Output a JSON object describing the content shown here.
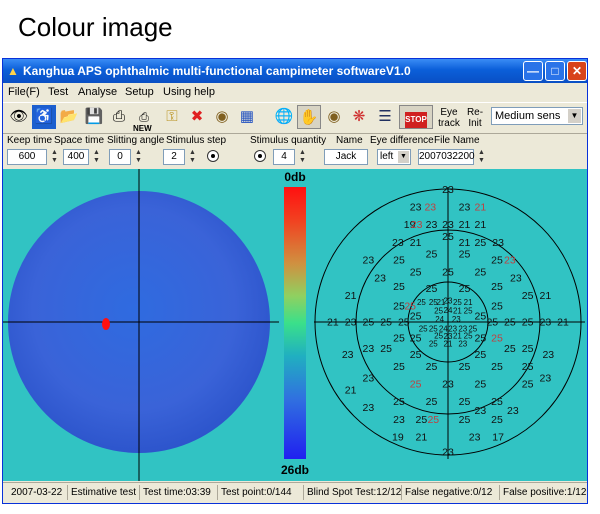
{
  "caption": "Colour image",
  "window": {
    "title": "Kanghua APS ophthalmic multi-functional campimeter softwareV1.0"
  },
  "menu": [
    "File(F)",
    "Test",
    "Analyse",
    "Setup",
    "Using help"
  ],
  "toolbar": {
    "eye_track_label": "Eye track",
    "reinit_label": "Re- Init",
    "new_label": "NEW",
    "stop_label": "STOP",
    "sensitivity_value": "Medium sens"
  },
  "params": {
    "labels": {
      "keep_time": "Keep time",
      "space_time": "Space time",
      "slitting_angle": "Slitting angle",
      "stimulus_step": "Stimulus step",
      "stimulus_quantity": "Stimulus quantity",
      "name": "Name",
      "eye_difference": "Eye difference",
      "file_name": "File Name"
    },
    "keep_time": "600",
    "space_time": "400",
    "slitting_angle": "0",
    "stimulus_step": "2",
    "stimulus_quantity": "4",
    "name": "Jack",
    "eye_difference": "left",
    "file_name": "2007032200"
  },
  "scale": {
    "top_label": "0db",
    "bottom_label": "26db"
  },
  "grid_points": [
    {
      "t": "23",
      "x": 0,
      "y": -22.5
    },
    {
      "t": "23",
      "x": -5.5,
      "y": -19.5
    },
    {
      "t": "23",
      "x": -3,
      "y": -19.5,
      "c": "#c04040"
    },
    {
      "t": "23",
      "x": 2.8,
      "y": -19.5
    },
    {
      "t": "21",
      "x": 5.5,
      "y": -19.5,
      "c": "#c04040"
    },
    {
      "t": "19",
      "x": -6.5,
      "y": -16.5
    },
    {
      "t": "23",
      "x": -5.3,
      "y": -16.5,
      "c": "#c04040"
    },
    {
      "t": "23",
      "x": -2.8,
      "y": -16.5
    },
    {
      "t": "23",
      "x": 0,
      "y": -16.5
    },
    {
      "t": "21",
      "x": 2.8,
      "y": -16.5
    },
    {
      "t": "21",
      "x": 5.5,
      "y": -16.5
    },
    {
      "t": "23",
      "x": -8.5,
      "y": -13.5
    },
    {
      "t": "21",
      "x": -5.5,
      "y": -13.5
    },
    {
      "t": "25",
      "x": 0,
      "y": -14.5
    },
    {
      "t": "21",
      "x": 2.8,
      "y": -13.5
    },
    {
      "t": "25",
      "x": 5.5,
      "y": -13.5
    },
    {
      "t": "23",
      "x": 8.5,
      "y": -13.5
    },
    {
      "t": "23",
      "x": -13.5,
      "y": -10.5
    },
    {
      "t": "25",
      "x": -8.3,
      "y": -10.5
    },
    {
      "t": "25",
      "x": -2.8,
      "y": -11.5
    },
    {
      "t": "25",
      "x": 2.8,
      "y": -11.5
    },
    {
      "t": "25",
      "x": 8.3,
      "y": -10.5
    },
    {
      "t": "23",
      "x": 10.5,
      "y": -10.5,
      "c": "#c04040"
    },
    {
      "t": "25",
      "x": -5.5,
      "y": -8.5
    },
    {
      "t": "25",
      "x": 0,
      "y": -8.5
    },
    {
      "t": "25",
      "x": 5.5,
      "y": -8.5
    },
    {
      "t": "23",
      "x": -11.5,
      "y": -7.5
    },
    {
      "t": "25",
      "x": -8.3,
      "y": -6
    },
    {
      "t": "25",
      "x": 8.3,
      "y": -6
    },
    {
      "t": "23",
      "x": 11.5,
      "y": -7.5
    },
    {
      "t": "25",
      "x": -2.8,
      "y": -5.7
    },
    {
      "t": "25",
      "x": 2.8,
      "y": -5.7
    },
    {
      "t": "21",
      "x": -16.5,
      "y": -4.5
    },
    {
      "t": "25",
      "x": -4.5,
      "y": -3.5
    },
    {
      "t": "25",
      "x": -2.5,
      "y": -3.5
    },
    {
      "t": "21",
      "x": -1.2,
      "y": -3.5
    },
    {
      "t": "23",
      "x": 0,
      "y": -3.7
    },
    {
      "t": "25",
      "x": 1.6,
      "y": -3.5
    },
    {
      "t": "21",
      "x": 3.4,
      "y": -3.5
    },
    {
      "t": "25",
      "x": 13.5,
      "y": -4.5
    },
    {
      "t": "21",
      "x": 16.5,
      "y": -4.5
    },
    {
      "t": "25",
      "x": -8.3,
      "y": -2.7
    },
    {
      "t": "25",
      "x": -6.4,
      "y": -2.7,
      "c": "#c04040"
    },
    {
      "t": "25",
      "x": -1.6,
      "y": -2
    },
    {
      "t": "24",
      "x": 0,
      "y": -2.1
    },
    {
      "t": "21",
      "x": 1.6,
      "y": -2
    },
    {
      "t": "25",
      "x": 3.4,
      "y": -2
    },
    {
      "t": "25",
      "x": 8.3,
      "y": -2.7
    },
    {
      "t": "25",
      "x": -5.5,
      "y": -1
    },
    {
      "t": "24",
      "x": -1.4,
      "y": -0.6
    },
    {
      "t": "23",
      "x": 1.4,
      "y": -0.6
    },
    {
      "t": "25",
      "x": 5.5,
      "y": -1
    },
    {
      "t": "21",
      "x": -19.5,
      "y": 0
    },
    {
      "t": "23",
      "x": -16.5,
      "y": 0
    },
    {
      "t": "25",
      "x": -13.5,
      "y": 0
    },
    {
      "t": "25",
      "x": -10.5,
      "y": 0
    },
    {
      "t": "25",
      "x": -7.5,
      "y": 0
    },
    {
      "t": "25",
      "x": 7.5,
      "y": 0
    },
    {
      "t": "25",
      "x": 10.5,
      "y": 0
    },
    {
      "t": "25",
      "x": 13.5,
      "y": 0
    },
    {
      "t": "23",
      "x": 16.5,
      "y": 0
    },
    {
      "t": "21",
      "x": 19.5,
      "y": 0
    },
    {
      "t": "25",
      "x": -4.2,
      "y": 1
    },
    {
      "t": "25",
      "x": -2.5,
      "y": 1
    },
    {
      "t": "24",
      "x": -0.8,
      "y": 1
    },
    {
      "t": "23",
      "x": 0.8,
      "y": 1
    },
    {
      "t": "23",
      "x": 2.5,
      "y": 1
    },
    {
      "t": "25",
      "x": 4.2,
      "y": 1
    },
    {
      "t": "25",
      "x": -8.3,
      "y": 2.7
    },
    {
      "t": "25",
      "x": -5.5,
      "y": 2.7
    },
    {
      "t": "25",
      "x": -1.6,
      "y": 2.2
    },
    {
      "t": "23",
      "x": 0,
      "y": 2.3
    },
    {
      "t": "21",
      "x": 1.6,
      "y": 2.2
    },
    {
      "t": "25",
      "x": 3.4,
      "y": 2.2
    },
    {
      "t": "25",
      "x": 5.5,
      "y": 2.7
    },
    {
      "t": "25",
      "x": 8.3,
      "y": 2.7,
      "c": "#c04040"
    },
    {
      "t": "23",
      "x": -13.5,
      "y": 4.5
    },
    {
      "t": "25",
      "x": -10.5,
      "y": 4.5
    },
    {
      "t": "25",
      "x": -2.5,
      "y": 3.6
    },
    {
      "t": "21",
      "x": 0,
      "y": 3.6
    },
    {
      "t": "23",
      "x": 2.5,
      "y": 3.6
    },
    {
      "t": "25",
      "x": 10.5,
      "y": 4.5
    },
    {
      "t": "25",
      "x": 13.5,
      "y": 4.5
    },
    {
      "t": "23",
      "x": -17,
      "y": 5.5
    },
    {
      "t": "25",
      "x": -5.5,
      "y": 5.5
    },
    {
      "t": "25",
      "x": 5.5,
      "y": 5.5
    },
    {
      "t": "23",
      "x": 17,
      "y": 5.5
    },
    {
      "t": "25",
      "x": -8.3,
      "y": 7.5
    },
    {
      "t": "25",
      "x": -2.8,
      "y": 7.5
    },
    {
      "t": "25",
      "x": 2.8,
      "y": 7.5
    },
    {
      "t": "25",
      "x": 8.3,
      "y": 7.5
    },
    {
      "t": "25",
      "x": 13.5,
      "y": 7.5
    },
    {
      "t": "23",
      "x": -13.5,
      "y": 9.5
    },
    {
      "t": "25",
      "x": -5.5,
      "y": 10.5,
      "c": "#c04040"
    },
    {
      "t": "23",
      "x": 0,
      "y": 10.5
    },
    {
      "t": "25",
      "x": 5.5,
      "y": 10.5
    },
    {
      "t": "25",
      "x": 13.5,
      "y": 10.5
    },
    {
      "t": "23",
      "x": 16.5,
      "y": 9.5
    },
    {
      "t": "21",
      "x": -16.5,
      "y": 11.5
    },
    {
      "t": "25",
      "x": -8.3,
      "y": 13.5
    },
    {
      "t": "25",
      "x": -2.8,
      "y": 13.5
    },
    {
      "t": "25",
      "x": 2.8,
      "y": 13.5
    },
    {
      "t": "25",
      "x": 8.3,
      "y": 13.5
    },
    {
      "t": "23",
      "x": -13.5,
      "y": 14.5
    },
    {
      "t": "23",
      "x": 5.5,
      "y": 15
    },
    {
      "t": "23",
      "x": 11,
      "y": 15
    },
    {
      "t": "23",
      "x": -8.3,
      "y": 16.5
    },
    {
      "t": "25",
      "x": -4.5,
      "y": 16.5
    },
    {
      "t": "25",
      "x": -2.5,
      "y": 16.5,
      "c": "#c04040"
    },
    {
      "t": "25",
      "x": 2.8,
      "y": 16.5
    },
    {
      "t": "25",
      "x": 8.3,
      "y": 16.5
    },
    {
      "t": "19",
      "x": -8.5,
      "y": 19.5
    },
    {
      "t": "21",
      "x": -4.5,
      "y": 19.5
    },
    {
      "t": "23",
      "x": 4.5,
      "y": 19.5
    },
    {
      "t": "17",
      "x": 8.5,
      "y": 19.5
    },
    {
      "t": "23",
      "x": 0,
      "y": 22
    }
  ],
  "status": {
    "date": "2007-03-22",
    "mode": "Estimative test",
    "test_time": "Test time:03:39",
    "test_point": "Test point:0/144",
    "blind_spot": "Blind Spot Test:12/12",
    "false_negative": "False negative:0/12",
    "false_positive": "False positive:1/12"
  }
}
